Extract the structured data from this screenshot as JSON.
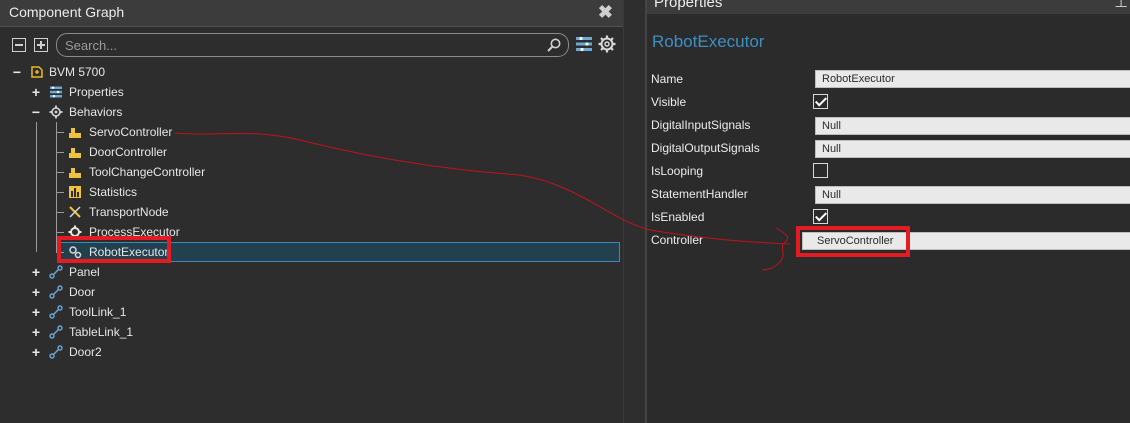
{
  "component_graph": {
    "title": "Component Graph",
    "close_glyph": "✖",
    "search": {
      "placeholder": "Search...",
      "value": ""
    },
    "tree": {
      "root": {
        "label": "BVM 5700",
        "toggle": "−"
      },
      "properties": {
        "label": "Properties",
        "toggle": "+"
      },
      "behaviors": {
        "label": "Behaviors",
        "toggle": "−"
      },
      "behavior_items": [
        {
          "label": "ServoController"
        },
        {
          "label": "DoorController"
        },
        {
          "label": "ToolChangeController"
        },
        {
          "label": "Statistics"
        },
        {
          "label": "TransportNode"
        },
        {
          "label": "ProcessExecutor"
        },
        {
          "label": "RobotExecutor"
        }
      ],
      "children": [
        {
          "label": "Panel",
          "toggle": "+"
        },
        {
          "label": "Door",
          "toggle": "+"
        },
        {
          "label": "ToolLink_1",
          "toggle": "+"
        },
        {
          "label": "TableLink_1",
          "toggle": "+"
        },
        {
          "label": "Door2",
          "toggle": "+"
        }
      ]
    }
  },
  "properties_panel": {
    "title": "Properties",
    "pin_glyph": "⊥",
    "object_name": "RobotExecutor",
    "fields": {
      "name": {
        "label": "Name",
        "value": "RobotExecutor"
      },
      "visible": {
        "label": "Visible",
        "checked": true
      },
      "digital_input_signals": {
        "label": "DigitalInputSignals",
        "value": "Null"
      },
      "digital_output_signals": {
        "label": "DigitalOutputSignals",
        "value": "Null"
      },
      "is_looping": {
        "label": "IsLooping",
        "checked": false
      },
      "statement_handler": {
        "label": "StatementHandler",
        "value": "Null"
      },
      "is_enabled": {
        "label": "IsEnabled",
        "checked": true
      },
      "controller": {
        "label": "Controller",
        "value": "ServoController"
      }
    }
  },
  "colors": {
    "accent": "#3d8fc4",
    "selection": "#22404e",
    "annotation_red": "#e31b23"
  }
}
